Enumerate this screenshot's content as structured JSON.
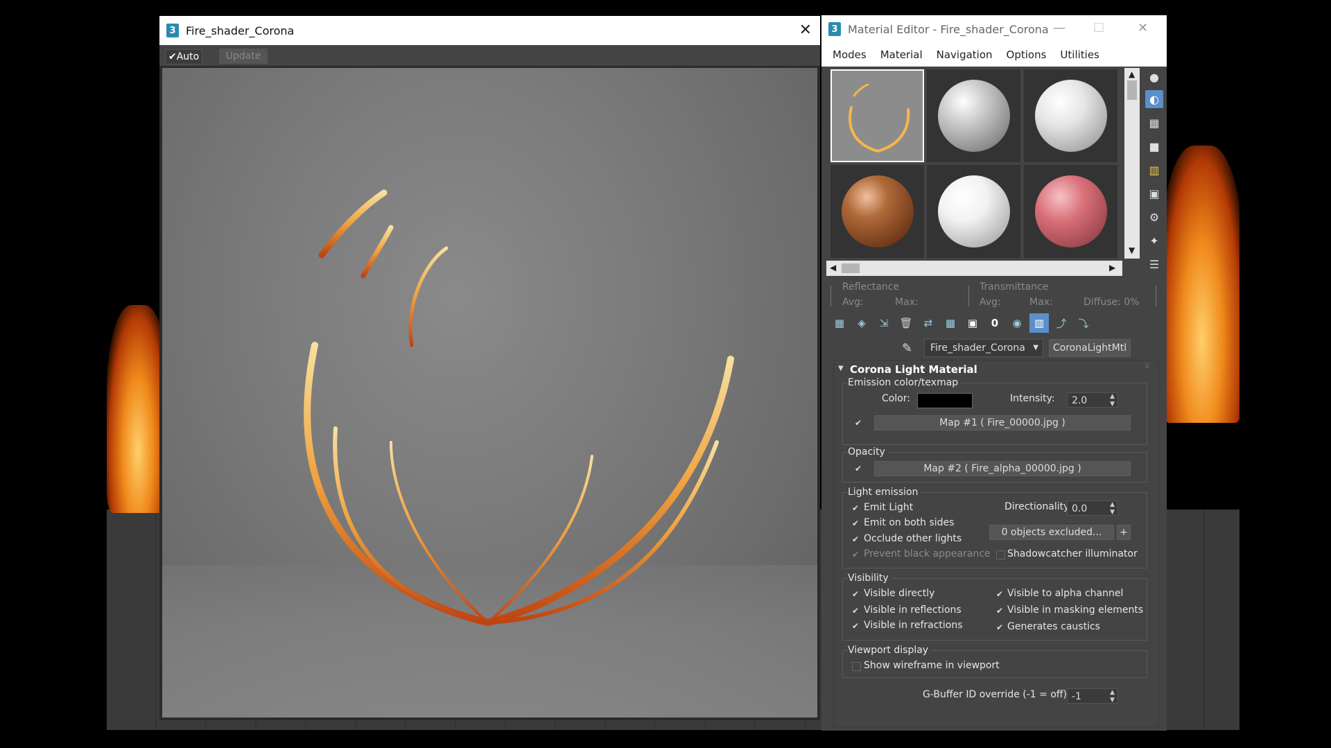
{
  "render_window": {
    "title": "Fire_shader_Corona",
    "auto_label": "Auto",
    "update_label": "Update"
  },
  "material_editor": {
    "title": "Material Editor - Fire_shader_Corona",
    "menu": [
      "Modes",
      "Material",
      "Navigation",
      "Options",
      "Utilities"
    ],
    "reflectance": {
      "label": "Reflectance",
      "avg": "Avg:",
      "max": "Max:"
    },
    "transmittance": {
      "label": "Transmittance",
      "avg": "Avg:",
      "max": "Max:",
      "diffuse": "Diffuse:  0%"
    },
    "material_name": "Fire_shader_Corona",
    "material_type": "CoronaLightMtl",
    "rollout_title": "Corona Light Material",
    "emission": {
      "group_label": "Emission color/texmap",
      "color_label": "Color:",
      "color_value": "#000000",
      "intensity_label": "Intensity:",
      "intensity_value": "2.0",
      "map_button": "Map #1 ( Fire_00000.jpg )"
    },
    "opacity": {
      "group_label": "Opacity",
      "map_button": "Map #2 ( Fire_alpha_00000.jpg )"
    },
    "light_emission": {
      "group_label": "Light emission",
      "emit_light": "Emit Light",
      "emit_both_sides": "Emit on both sides",
      "occlude_other": "Occlude other lights",
      "prevent_black": "Prevent black appearance",
      "directionality_label": "Directionality:",
      "directionality_value": "0.0",
      "excluded_button": "0 objects excluded...",
      "shadowcatcher": "Shadowcatcher illuminator"
    },
    "visibility": {
      "group_label": "Visibility",
      "visible_directly": "Visible directly",
      "visible_reflections": "Visible in reflections",
      "visible_refractions": "Visible in refractions",
      "visible_alpha": "Visible to alpha channel",
      "visible_masking": "Visible in masking elements",
      "generates_caustics": "Generates caustics"
    },
    "viewport_display": {
      "group_label": "Viewport display",
      "show_wireframe": "Show wireframe in viewport"
    },
    "gbuffer": {
      "label": "G-Buffer ID override (-1 = off):",
      "value": "-1"
    },
    "slot_colors": [
      "#9a9a9a",
      "#d8d8d8",
      "#e6e6e6",
      "#8a4a26",
      "#f0f0f0",
      "#d9707a"
    ]
  }
}
